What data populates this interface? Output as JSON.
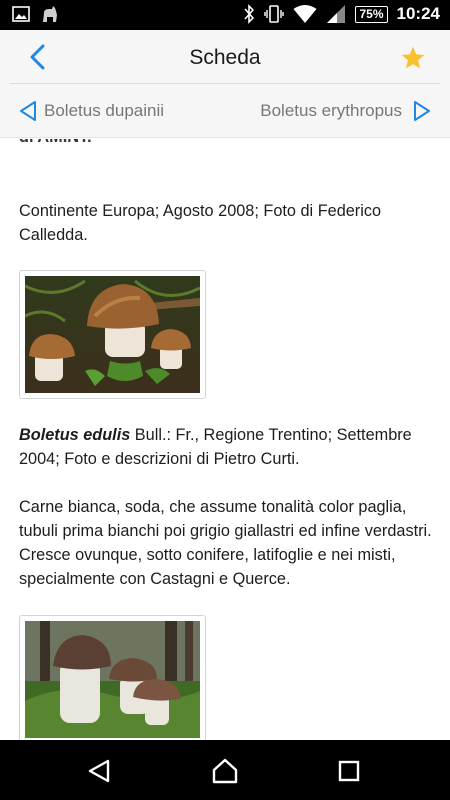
{
  "status": {
    "battery": "75%",
    "time": "10:24",
    "icons": [
      "image-icon",
      "android-icon",
      "bluetooth-icon",
      "vibrate-icon",
      "wifi-icon",
      "signal-icon"
    ]
  },
  "header": {
    "title": "Scheda",
    "back_icon": "chevron-left-icon",
    "favorite_icon": "star-icon",
    "accent_color": "#1e88e5",
    "star_color": "#fbc02d"
  },
  "nav": {
    "prev_label": "Boletus dupainii",
    "next_label": "Boletus erythropus"
  },
  "content": {
    "cut_text": "di AMINT.",
    "entries": [
      {
        "text": "Continente Europa; Agosto 2008; Foto di Federico Calledda."
      },
      {
        "species": "Boletus edulis",
        "text": " Bull.: Fr., Regione Trentino; Settembre 2004; Foto e descrizioni di Pietro Curti."
      },
      {
        "text": "Carne bianca, soda, che assume tonalità color paglia, tubuli prima bianchi poi grigio giallastri ed infine verdastri. Cresce ovunque, sotto conifere, latifoglie e nei misti, specialmente con Castagni e Querce."
      }
    ]
  },
  "system_nav": {
    "icons": [
      "back-triangle-icon",
      "home-icon",
      "recents-icon"
    ]
  }
}
